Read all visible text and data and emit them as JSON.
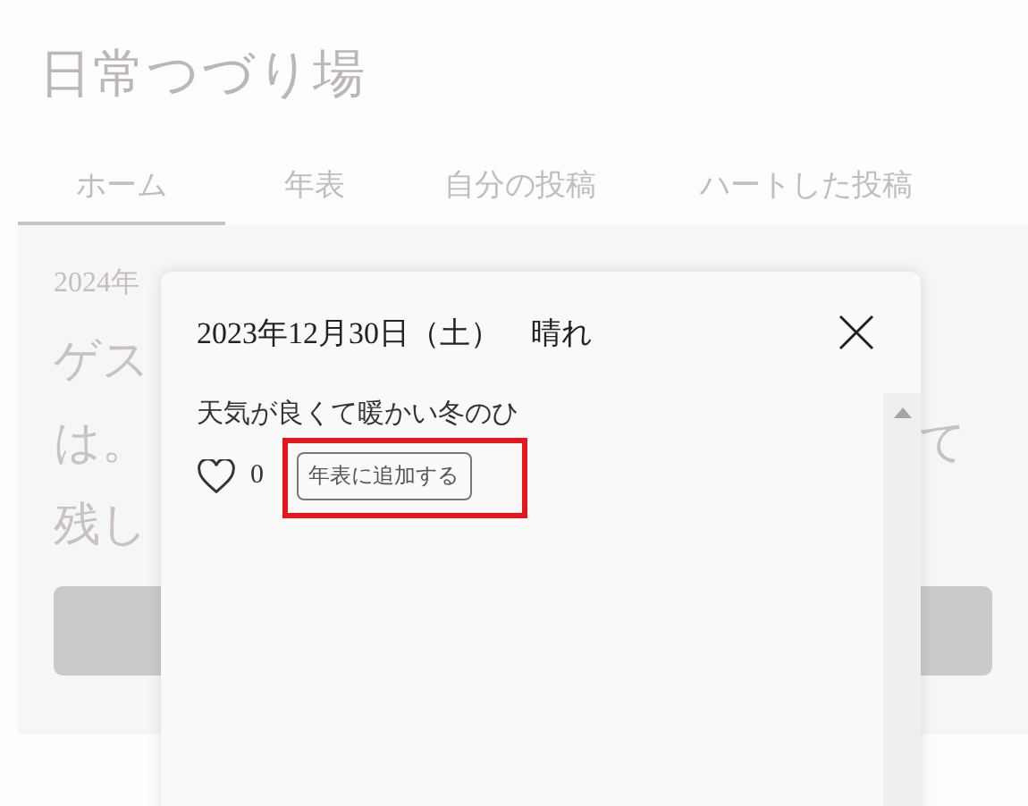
{
  "site_title": "日常つづり場",
  "tabs": [
    {
      "label": "ホーム",
      "selected": true
    },
    {
      "label": "年表",
      "selected": false
    },
    {
      "label": "自分の投稿",
      "selected": false
    },
    {
      "label": "ハートした投稿",
      "selected": false
    }
  ],
  "background": {
    "date": "2024年",
    "lines": [
      {
        "left": "ゲス"
      },
      {
        "left": "は。",
        "right": "て"
      },
      {
        "left": "残し"
      }
    ]
  },
  "modal": {
    "title": "2023年12月30日（土）　晴れ",
    "body": "天気が良くて暖かい冬のひ",
    "likes": "0",
    "liked": false,
    "add_button": "年表に追加する",
    "highlighted": true
  }
}
